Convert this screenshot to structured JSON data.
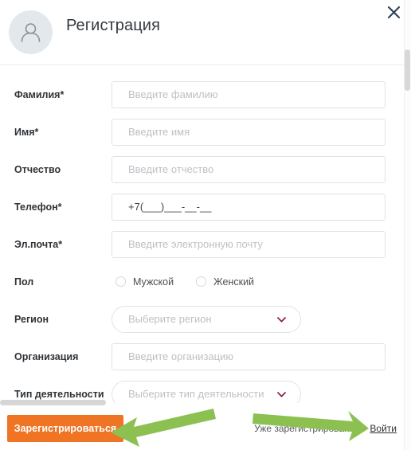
{
  "header": {
    "title": "Регистрация",
    "avatar_icon": "user-avatar-icon",
    "close_icon": "close-icon"
  },
  "form": {
    "fields": [
      {
        "key": "lastname",
        "label": "Фамилия*",
        "type": "text",
        "placeholder": "Введите фамилию",
        "value": ""
      },
      {
        "key": "firstname",
        "label": "Имя*",
        "type": "text",
        "placeholder": "Введите имя",
        "value": ""
      },
      {
        "key": "middlename",
        "label": "Отчество",
        "type": "text",
        "placeholder": "Введите отчество",
        "value": ""
      },
      {
        "key": "phone",
        "label": "Телефон*",
        "type": "text",
        "placeholder": "",
        "value": "+7(___)___-__-__"
      },
      {
        "key": "email",
        "label": "Эл.почта*",
        "type": "text",
        "placeholder": "Введите электронную почту",
        "value": ""
      },
      {
        "key": "gender",
        "label": "Пол",
        "type": "radio",
        "options": [
          "Мужской",
          "Женский"
        ],
        "selected": ""
      },
      {
        "key": "region",
        "label": "Регион",
        "type": "select",
        "placeholder": "Выберите регион",
        "value": ""
      },
      {
        "key": "organization",
        "label": "Организация",
        "type": "text",
        "placeholder": "Введите организацию",
        "value": ""
      },
      {
        "key": "activity_type",
        "label": "Тип деятельности",
        "type": "select",
        "placeholder": "Выберите тип деятельности",
        "value": ""
      }
    ]
  },
  "footer": {
    "submit_label": "Зарегистрироваться",
    "login_hint": "Уже зарегистрированы?",
    "login_link": "Войти"
  },
  "colors": {
    "submit_orange": "#ef7423",
    "annotation_green": "#8cc152",
    "caret_crimson": "#8e1f38",
    "avatar_bg": "#e3e8ec",
    "label_text": "#2f3337",
    "placeholder_text": "#bdc1c5"
  },
  "annotations": {
    "arrow_left_target": "Зарегистрироваться",
    "arrow_right_target": "Войти"
  }
}
